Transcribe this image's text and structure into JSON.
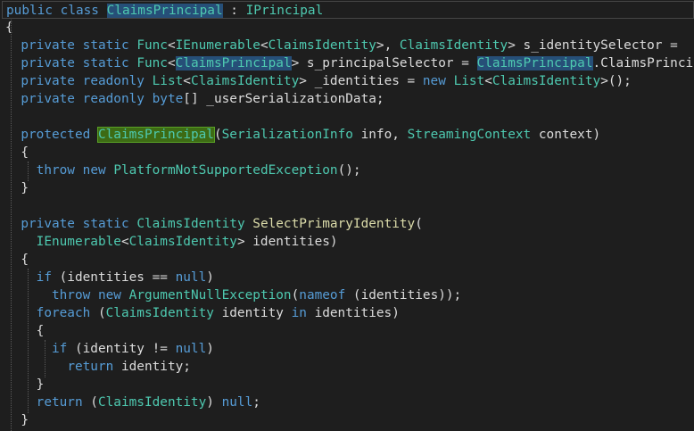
{
  "editor": {
    "language": "C#",
    "theme": {
      "background": "#1e1e1e",
      "keyword": "#569cd6",
      "type": "#4ec9b0",
      "method": "#dcdcaa",
      "text": "#dcdcdc",
      "highlight": "#264f78",
      "definition_highlight": "#3d6b14"
    },
    "lines": [
      {
        "tokens": [
          {
            "t": "public",
            "c": "kw"
          },
          {
            "t": " ",
            "c": "pl"
          },
          {
            "t": "class",
            "c": "kw"
          },
          {
            "t": " ",
            "c": "pl"
          },
          {
            "t": "ClaimsPrincipal",
            "c": "hl-blue"
          },
          {
            "t": " : ",
            "c": "pl"
          },
          {
            "t": "IPrincipal",
            "c": "ty"
          }
        ]
      },
      {
        "tokens": [
          {
            "t": "{",
            "c": "pl"
          }
        ]
      },
      {
        "tokens": [
          {
            "t": "  ",
            "c": "pl"
          },
          {
            "t": "private",
            "c": "kw"
          },
          {
            "t": " ",
            "c": "pl"
          },
          {
            "t": "static",
            "c": "kw"
          },
          {
            "t": " ",
            "c": "pl"
          },
          {
            "t": "Func",
            "c": "ty"
          },
          {
            "t": "<",
            "c": "pl"
          },
          {
            "t": "IEnumerable",
            "c": "ty"
          },
          {
            "t": "<",
            "c": "pl"
          },
          {
            "t": "ClaimsIdentity",
            "c": "ty"
          },
          {
            "t": ">, ",
            "c": "pl"
          },
          {
            "t": "ClaimsIdentity",
            "c": "ty"
          },
          {
            "t": "> s_identitySelector = ",
            "c": "pl"
          }
        ]
      },
      {
        "tokens": [
          {
            "t": "  ",
            "c": "pl"
          },
          {
            "t": "private",
            "c": "kw"
          },
          {
            "t": " ",
            "c": "pl"
          },
          {
            "t": "static",
            "c": "kw"
          },
          {
            "t": " ",
            "c": "pl"
          },
          {
            "t": "Func",
            "c": "ty"
          },
          {
            "t": "<",
            "c": "pl"
          },
          {
            "t": "ClaimsPrincipal",
            "c": "hl-blue"
          },
          {
            "t": "> s_principalSelector = ",
            "c": "pl"
          },
          {
            "t": "ClaimsPrincipal",
            "c": "hl-blue"
          },
          {
            "t": ".ClaimsPrincipalSelector;",
            "c": "pl"
          }
        ]
      },
      {
        "tokens": [
          {
            "t": "  ",
            "c": "pl"
          },
          {
            "t": "private",
            "c": "kw"
          },
          {
            "t": " ",
            "c": "pl"
          },
          {
            "t": "readonly",
            "c": "kw"
          },
          {
            "t": " ",
            "c": "pl"
          },
          {
            "t": "List",
            "c": "ty"
          },
          {
            "t": "<",
            "c": "pl"
          },
          {
            "t": "ClaimsIdentity",
            "c": "ty"
          },
          {
            "t": "> _identities = ",
            "c": "pl"
          },
          {
            "t": "new",
            "c": "kw"
          },
          {
            "t": " ",
            "c": "pl"
          },
          {
            "t": "List",
            "c": "ty"
          },
          {
            "t": "<",
            "c": "pl"
          },
          {
            "t": "ClaimsIdentity",
            "c": "ty"
          },
          {
            "t": ">();",
            "c": "pl"
          }
        ]
      },
      {
        "tokens": [
          {
            "t": "  ",
            "c": "pl"
          },
          {
            "t": "private",
            "c": "kw"
          },
          {
            "t": " ",
            "c": "pl"
          },
          {
            "t": "readonly",
            "c": "kw"
          },
          {
            "t": " ",
            "c": "pl"
          },
          {
            "t": "byte",
            "c": "kw"
          },
          {
            "t": "[] _userSerializationData;",
            "c": "pl"
          }
        ]
      },
      {
        "tokens": []
      },
      {
        "tokens": [
          {
            "t": "  ",
            "c": "pl"
          },
          {
            "t": "protected",
            "c": "kw"
          },
          {
            "t": " ",
            "c": "pl"
          },
          {
            "t": "ClaimsPrincipal",
            "c": "hl-green"
          },
          {
            "t": "(",
            "c": "pl"
          },
          {
            "t": "SerializationInfo",
            "c": "ty"
          },
          {
            "t": " info, ",
            "c": "pl"
          },
          {
            "t": "StreamingContext",
            "c": "ty"
          },
          {
            "t": " context)",
            "c": "pl"
          }
        ]
      },
      {
        "tokens": [
          {
            "t": "  {",
            "c": "pl"
          }
        ]
      },
      {
        "tokens": [
          {
            "t": "    ",
            "c": "pl"
          },
          {
            "t": "throw",
            "c": "kw"
          },
          {
            "t": " ",
            "c": "pl"
          },
          {
            "t": "new",
            "c": "kw"
          },
          {
            "t": " ",
            "c": "pl"
          },
          {
            "t": "PlatformNotSupportedException",
            "c": "ty"
          },
          {
            "t": "();",
            "c": "pl"
          }
        ]
      },
      {
        "tokens": [
          {
            "t": "  }",
            "c": "pl"
          }
        ]
      },
      {
        "tokens": []
      },
      {
        "tokens": [
          {
            "t": "  ",
            "c": "pl"
          },
          {
            "t": "private",
            "c": "kw"
          },
          {
            "t": " ",
            "c": "pl"
          },
          {
            "t": "static",
            "c": "kw"
          },
          {
            "t": " ",
            "c": "pl"
          },
          {
            "t": "ClaimsIdentity",
            "c": "ty"
          },
          {
            "t": " ",
            "c": "pl"
          },
          {
            "t": "SelectPrimaryIdentity",
            "c": "fn"
          },
          {
            "t": "(",
            "c": "pl"
          }
        ]
      },
      {
        "tokens": [
          {
            "t": "    ",
            "c": "pl"
          },
          {
            "t": "IEnumerable",
            "c": "ty"
          },
          {
            "t": "<",
            "c": "pl"
          },
          {
            "t": "ClaimsIdentity",
            "c": "ty"
          },
          {
            "t": "> identities)",
            "c": "pl"
          }
        ]
      },
      {
        "tokens": [
          {
            "t": "  {",
            "c": "pl"
          }
        ]
      },
      {
        "tokens": [
          {
            "t": "    ",
            "c": "pl"
          },
          {
            "t": "if",
            "c": "kw"
          },
          {
            "t": " (identities == ",
            "c": "pl"
          },
          {
            "t": "null",
            "c": "kw"
          },
          {
            "t": ")",
            "c": "pl"
          }
        ]
      },
      {
        "tokens": [
          {
            "t": "      ",
            "c": "pl"
          },
          {
            "t": "throw",
            "c": "kw"
          },
          {
            "t": " ",
            "c": "pl"
          },
          {
            "t": "new",
            "c": "kw"
          },
          {
            "t": " ",
            "c": "pl"
          },
          {
            "t": "ArgumentNullException",
            "c": "ty"
          },
          {
            "t": "(",
            "c": "pl"
          },
          {
            "t": "nameof",
            "c": "kw"
          },
          {
            "t": " (identities));",
            "c": "pl"
          }
        ]
      },
      {
        "tokens": [
          {
            "t": "    ",
            "c": "pl"
          },
          {
            "t": "foreach",
            "c": "kw"
          },
          {
            "t": " (",
            "c": "pl"
          },
          {
            "t": "ClaimsIdentity",
            "c": "ty"
          },
          {
            "t": " identity ",
            "c": "pl"
          },
          {
            "t": "in",
            "c": "kw"
          },
          {
            "t": " identities)",
            "c": "pl"
          }
        ]
      },
      {
        "tokens": [
          {
            "t": "    {",
            "c": "pl"
          }
        ]
      },
      {
        "tokens": [
          {
            "t": "      ",
            "c": "pl"
          },
          {
            "t": "if",
            "c": "kw"
          },
          {
            "t": " (identity != ",
            "c": "pl"
          },
          {
            "t": "null",
            "c": "kw"
          },
          {
            "t": ")",
            "c": "pl"
          }
        ]
      },
      {
        "tokens": [
          {
            "t": "        ",
            "c": "pl"
          },
          {
            "t": "return",
            "c": "kw"
          },
          {
            "t": " identity;",
            "c": "pl"
          }
        ]
      },
      {
        "tokens": [
          {
            "t": "    }",
            "c": "pl"
          }
        ]
      },
      {
        "tokens": [
          {
            "t": "    ",
            "c": "pl"
          },
          {
            "t": "return",
            "c": "kw"
          },
          {
            "t": " (",
            "c": "pl"
          },
          {
            "t": "ClaimsIdentity",
            "c": "ty"
          },
          {
            "t": ") ",
            "c": "pl"
          },
          {
            "t": "null",
            "c": "kw"
          },
          {
            "t": ";",
            "c": "pl"
          }
        ]
      },
      {
        "tokens": [
          {
            "t": "  }",
            "c": "pl"
          }
        ]
      }
    ]
  }
}
